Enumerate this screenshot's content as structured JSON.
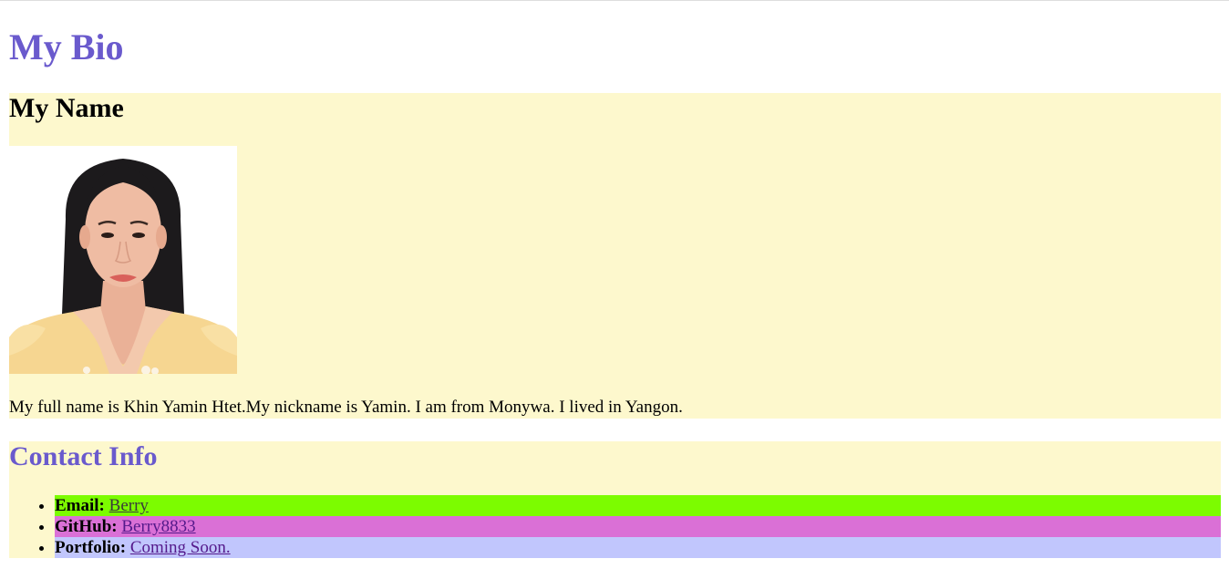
{
  "page": {
    "title": "My Bio"
  },
  "name_section": {
    "heading": "My Name",
    "photo_alt": "portrait-photo",
    "bio": "My full name is Khin Yamin Htet.My nickname is Yamin. I am from Monywa. I lived in Yangon."
  },
  "contact": {
    "heading": "Contact Info",
    "items": [
      {
        "label": "Email:",
        "link_text": "Berry",
        "bg": "#7cfc00"
      },
      {
        "label": "GitHub:",
        "link_text": "Berry8833",
        "bg": "#da70d6"
      },
      {
        "label": "Portfolio:",
        "link_text": "Coming Soon.",
        "bg": "#c1c6fd"
      }
    ]
  },
  "colors": {
    "heading_accent": "#6a5acd",
    "section_bg": "#fdf8cd",
    "link": "#551a8b"
  }
}
